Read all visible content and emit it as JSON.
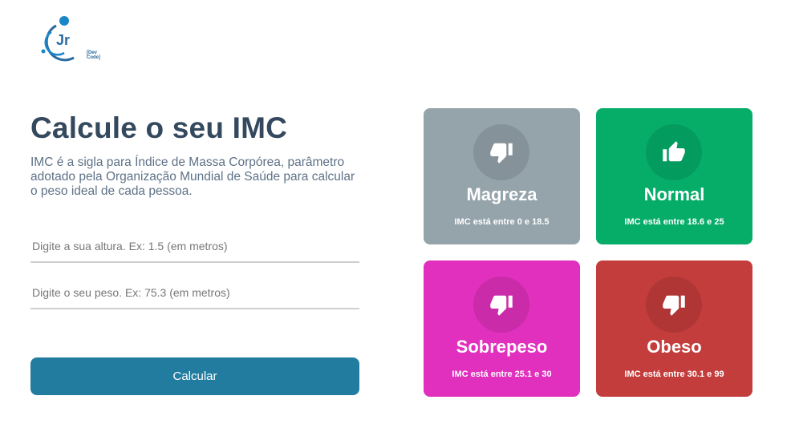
{
  "logo": {
    "text": "[Dev Code]"
  },
  "main": {
    "title": "Calcule o seu IMC",
    "description": "IMC é a sigla para Índice de Massa Corpórea, parâmetro adotado pela Organização Mundial de Saúde para calcular o peso ideal de cada pessoa."
  },
  "form": {
    "height_placeholder": "Digite a sua altura. Ex: 1.5 (em metros)",
    "weight_placeholder": "Digite o seu peso. Ex: 75.3 (em metros)",
    "submit_label": "Calcular"
  },
  "cards": [
    {
      "name": "Magreza",
      "prefix": "IMC está entre",
      "min": "0",
      "sep": "e",
      "max": "18.5",
      "icon": "thumbs-down-icon",
      "color": "#95a3ab"
    },
    {
      "name": "Normal",
      "prefix": "IMC está entre",
      "min": "18.6",
      "sep": "e",
      "max": "25",
      "icon": "thumbs-up-icon",
      "color": "#05ad69"
    },
    {
      "name": "Sobrepeso",
      "prefix": "IMC está entre",
      "min": "25.1",
      "sep": "e",
      "max": "30",
      "icon": "thumbs-down-icon",
      "color": "#e030bd"
    },
    {
      "name": "Obeso",
      "prefix": "IMC está entre",
      "min": "30.1",
      "sep": "e",
      "max": "99",
      "icon": "thumbs-down-icon",
      "color": "#c43d3d"
    }
  ]
}
